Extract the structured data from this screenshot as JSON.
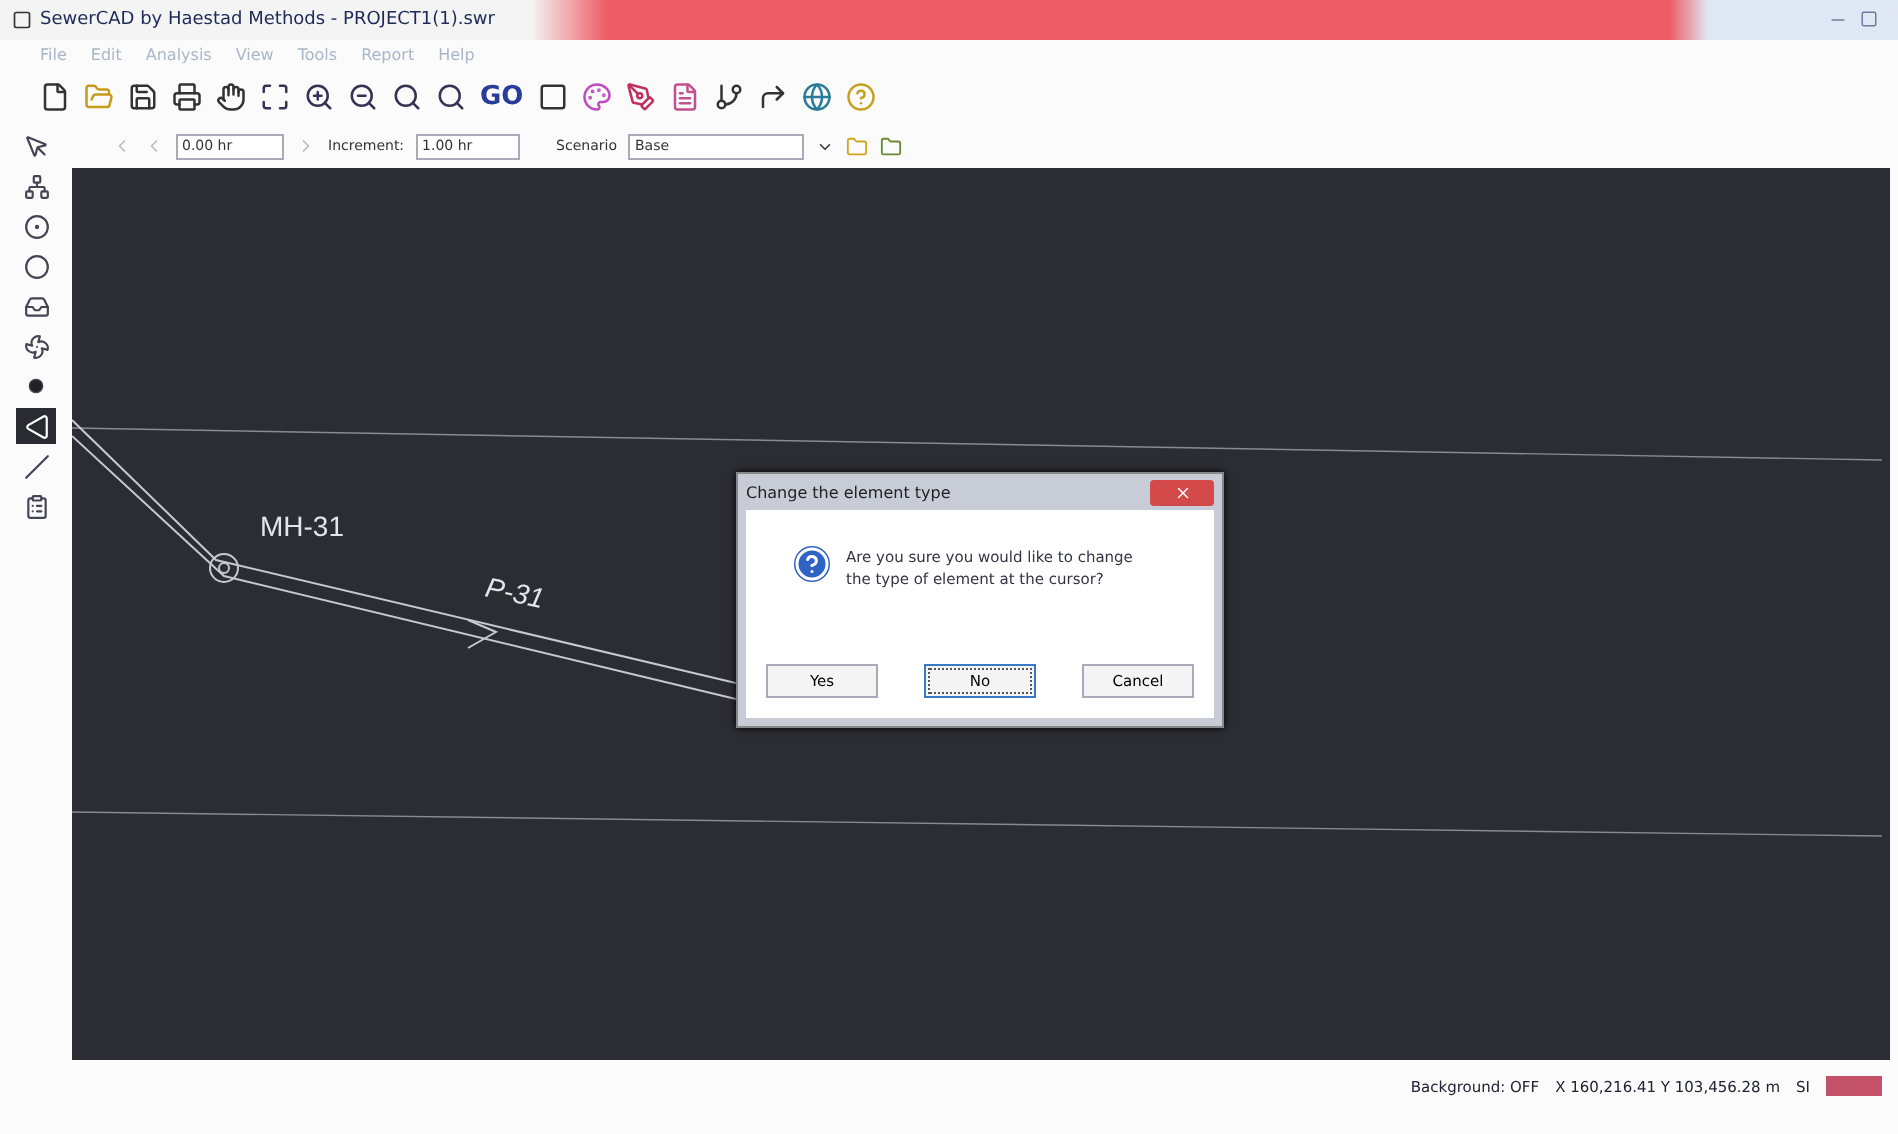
{
  "window": {
    "title": "SewerCAD by Haestad Methods - PROJECT1(1).swr"
  },
  "menu": [
    "File",
    "Edit",
    "Analysis",
    "View",
    "Tools",
    "Report",
    "Help"
  ],
  "toolbar": {
    "go_label": "GO"
  },
  "time_bar": {
    "time": "0.00 hr",
    "increment_label": "Increment:",
    "increment": "1.00 hr",
    "scenario_label": "Scenario",
    "scenario": "Base"
  },
  "palette": [
    {
      "kind": "pointer",
      "selected": false
    },
    {
      "kind": "network",
      "selected": false
    },
    {
      "kind": "manhole",
      "selected": false
    },
    {
      "kind": "node",
      "selected": false
    },
    {
      "kind": "outlet",
      "selected": false
    },
    {
      "kind": "pump",
      "selected": false
    },
    {
      "kind": "junction",
      "selected": false
    },
    {
      "kind": "wetwell",
      "selected": true
    },
    {
      "kind": "pipe",
      "selected": false
    },
    {
      "kind": "report",
      "selected": false
    }
  ],
  "canvas": {
    "node_label": "MH-31",
    "pipe_label": "P-31"
  },
  "dialog": {
    "title": "Change the element type",
    "message": "Are you sure you would like to change the type of element at the cursor?",
    "buttons": [
      {
        "label": "Yes",
        "selected": false
      },
      {
        "label": "No",
        "selected": true
      },
      {
        "label": "Cancel",
        "selected": false
      }
    ]
  },
  "status_bar": {
    "background": "Background: OFF",
    "coordinates": "X 160,216.41 Y 103,456.28 m",
    "units": "SI"
  }
}
